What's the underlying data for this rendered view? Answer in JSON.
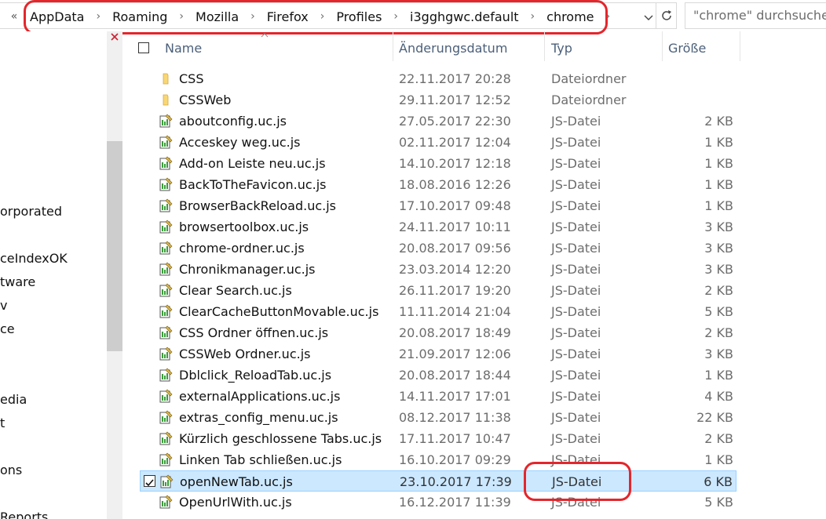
{
  "address": {
    "overflow_glyph": "«",
    "crumbs": [
      "AppData",
      "Roaming",
      "Mozilla",
      "Firefox",
      "Profiles",
      "i3gghgwc.default",
      "chrome"
    ],
    "separator": "›"
  },
  "search": {
    "placeholder": "\"chrome\" durchsuchen"
  },
  "nav": {
    "items": [
      "orporated",
      "ceIndexOK",
      "tware",
      "v",
      "ce",
      "edia",
      "t",
      "ons",
      "Reports"
    ]
  },
  "columns": {
    "name": "Name",
    "date": "Änderungsdatum",
    "type": "Typ",
    "size": "Größe"
  },
  "rows": [
    {
      "name": "CSS",
      "date": "22.11.2017 20:28",
      "type": "Dateiordner",
      "size": "",
      "icon": "folder-icon",
      "selected": false
    },
    {
      "name": "CSSWeb",
      "date": "29.11.2017 12:52",
      "type": "Dateiordner",
      "size": "",
      "icon": "folder-icon",
      "selected": false
    },
    {
      "name": "aboutconfig.uc.js",
      "date": "27.05.2017 22:30",
      "type": "JS-Datei",
      "size": "2 KB",
      "icon": "js-file-icon",
      "selected": false
    },
    {
      "name": "Acceskey weg.uc.js",
      "date": "02.11.2017 12:04",
      "type": "JS-Datei",
      "size": "1 KB",
      "icon": "js-file-icon",
      "selected": false
    },
    {
      "name": "Add-on Leiste neu.uc.js",
      "date": "14.10.2017 12:18",
      "type": "JS-Datei",
      "size": "1 KB",
      "icon": "js-file-icon",
      "selected": false
    },
    {
      "name": "BackToTheFavicon.uc.js",
      "date": "18.08.2016 12:26",
      "type": "JS-Datei",
      "size": "1 KB",
      "icon": "js-file-icon",
      "selected": false
    },
    {
      "name": "BrowserBackReload.uc.js",
      "date": "17.10.2017 09:48",
      "type": "JS-Datei",
      "size": "1 KB",
      "icon": "js-file-icon",
      "selected": false
    },
    {
      "name": "browsertoolbox.uc.js",
      "date": "24.11.2017 10:11",
      "type": "JS-Datei",
      "size": "3 KB",
      "icon": "js-file-icon",
      "selected": false
    },
    {
      "name": "chrome-ordner.uc.js",
      "date": "20.08.2017 09:56",
      "type": "JS-Datei",
      "size": "3 KB",
      "icon": "js-file-icon",
      "selected": false
    },
    {
      "name": "Chronikmanager.uc.js",
      "date": "23.03.2014 12:20",
      "type": "JS-Datei",
      "size": "3 KB",
      "icon": "js-file-icon",
      "selected": false
    },
    {
      "name": "Clear Search.uc.js",
      "date": "26.11.2017 19:20",
      "type": "JS-Datei",
      "size": "2 KB",
      "icon": "js-file-icon",
      "selected": false
    },
    {
      "name": "ClearCacheButtonMovable.uc.js",
      "date": "11.11.2014 21:04",
      "type": "JS-Datei",
      "size": "5 KB",
      "icon": "js-file-icon",
      "selected": false
    },
    {
      "name": "CSS Ordner öffnen.uc.js",
      "date": "20.08.2017 18:49",
      "type": "JS-Datei",
      "size": "2 KB",
      "icon": "js-file-icon",
      "selected": false
    },
    {
      "name": "CSSWeb Ordner.uc.js",
      "date": "21.09.2017 12:06",
      "type": "JS-Datei",
      "size": "3 KB",
      "icon": "js-file-icon",
      "selected": false
    },
    {
      "name": "Dblclick_ReloadTab.uc.js",
      "date": "20.08.2017 18:44",
      "type": "JS-Datei",
      "size": "1 KB",
      "icon": "js-file-icon",
      "selected": false
    },
    {
      "name": "externalApplications.uc.js",
      "date": "14.11.2017 17:01",
      "type": "JS-Datei",
      "size": "4 KB",
      "icon": "js-file-icon",
      "selected": false
    },
    {
      "name": "extras_config_menu.uc.js",
      "date": "08.12.2017 11:38",
      "type": "JS-Datei",
      "size": "22 KB",
      "icon": "js-file-icon",
      "selected": false
    },
    {
      "name": "Kürzlich geschlossene Tabs.uc.js",
      "date": "17.11.2017 10:47",
      "type": "JS-Datei",
      "size": "2 KB",
      "icon": "js-file-icon",
      "selected": false
    },
    {
      "name": "Linken Tab schließen.uc.js",
      "date": "16.10.2017 09:29",
      "type": "JS-Datei",
      "size": "1 KB",
      "icon": "js-file-icon",
      "selected": false
    },
    {
      "name": "openNewTab.uc.js",
      "date": "23.10.2017 17:39",
      "type": "JS-Datei",
      "size": "6 KB",
      "icon": "js-file-icon",
      "selected": true
    },
    {
      "name": "OpenUrlWith.uc.js",
      "date": "16.12.2017 11:39",
      "type": "JS-Datei",
      "size": "5 KB",
      "icon": "js-file-icon",
      "selected": false
    }
  ],
  "colors": {
    "selection_fill": "#cce8ff",
    "selection_border": "#99d1ff",
    "annotation": "#e3262c",
    "header_text": "#4c607a",
    "folder": "#f8d775"
  }
}
